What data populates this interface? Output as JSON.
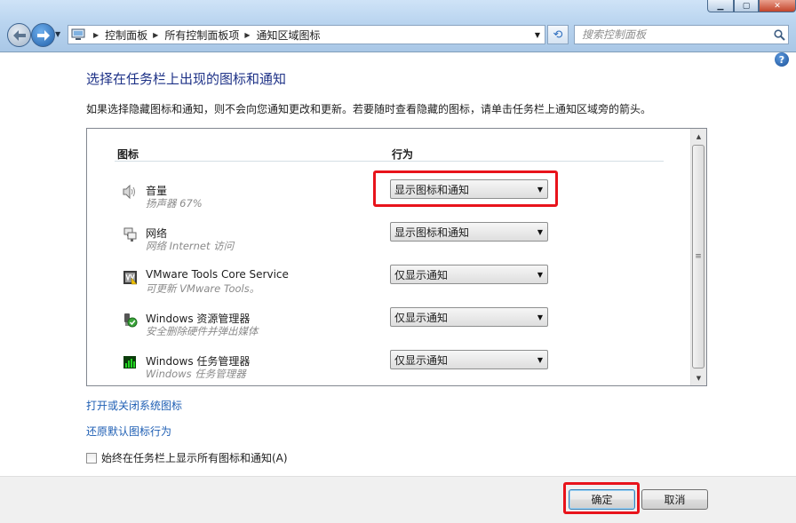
{
  "window": {
    "minimize_glyph": "▁",
    "maximize_glyph": "▢",
    "close_glyph": "✕"
  },
  "nav": {
    "back_icon": "arrow-left-icon",
    "forward_icon": "arrow-right-icon",
    "recent_glyph": "▼"
  },
  "address": {
    "crumbs": [
      "控制面板",
      "所有控制面板项",
      "通知区域图标"
    ],
    "separator": "▶",
    "dropdown_glyph": "▼"
  },
  "refresh": {
    "glyph": "⟲"
  },
  "search": {
    "placeholder": "搜索控制面板"
  },
  "help": {
    "glyph": "?"
  },
  "page": {
    "title": "选择在任务栏上出现的图标和通知",
    "description": "如果选择隐藏图标和通知，则不会向您通知更改和更新。若要随时查看隐藏的图标，请单击任务栏上通知区域旁的箭头。"
  },
  "table": {
    "col_icon": "图标",
    "col_behavior": "行为",
    "rows": [
      {
        "name": "音量",
        "sub": "扬声器 67%",
        "behavior": "显示图标和通知",
        "icon": "speaker-icon"
      },
      {
        "name": "网络",
        "sub": "网络 Internet 访问",
        "behavior": "显示图标和通知",
        "icon": "network-icon"
      },
      {
        "name": "VMware Tools Core Service",
        "sub": "可更新 VMware Tools。",
        "behavior": "仅显示通知",
        "icon": "vmware-icon"
      },
      {
        "name": "Windows 资源管理器",
        "sub": "安全删除硬件并弹出媒体",
        "behavior": "仅显示通知",
        "icon": "usb-safe-remove-icon"
      },
      {
        "name": "Windows 任务管理器",
        "sub": "Windows 任务管理器",
        "behavior": "仅显示通知",
        "icon": "task-manager-icon"
      }
    ],
    "combo_arrow": "▼",
    "scroll_up": "▲",
    "scroll_down": "▼",
    "scroll_grip": "≡"
  },
  "links": {
    "system_icons": "打开或关闭系统图标",
    "restore_defaults": "还原默认图标行为"
  },
  "always_show": {
    "label": "始终在任务栏上显示所有图标和通知(A)",
    "checked": false
  },
  "buttons": {
    "ok": "确定",
    "cancel": "取消"
  },
  "colors": {
    "title": "#1e3287",
    "link": "#1f5fb4",
    "highlight": "#e8131b"
  }
}
